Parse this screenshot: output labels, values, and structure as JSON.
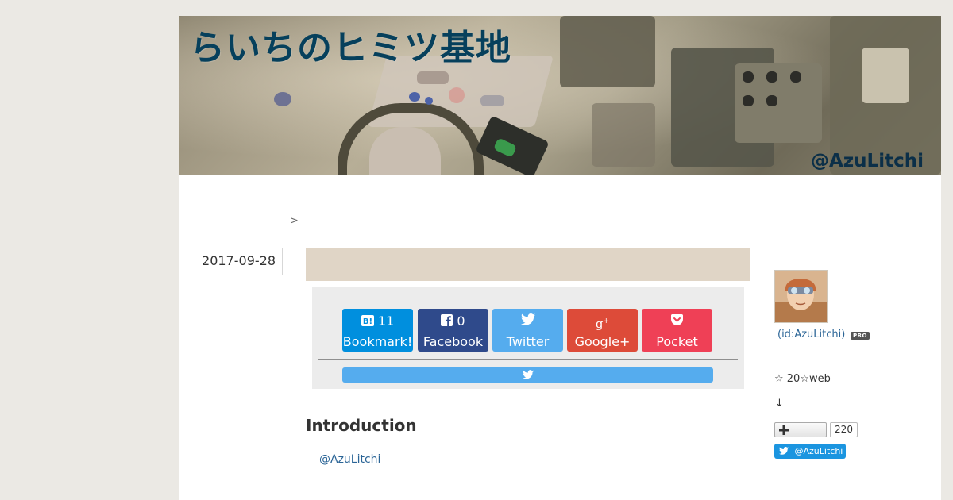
{
  "header": {
    "title": "らいちのヒミツ基地",
    "handle": "@AzuLitchi"
  },
  "breadcrumb": {
    "separator": ">"
  },
  "entry": {
    "date": "2017-09-28",
    "title": ""
  },
  "share": {
    "buttons": [
      {
        "service": "hatena",
        "count": "11",
        "label": "Bookmark!",
        "color": "#008fde",
        "icon": "hatena-bookmark-icon"
      },
      {
        "service": "facebook",
        "count": "0",
        "label": "Facebook",
        "color": "#2f4a8b",
        "icon": "facebook-icon"
      },
      {
        "service": "twitter",
        "count": "",
        "label": "Twitter",
        "color": "#55acee",
        "icon": "twitter-bird-icon"
      },
      {
        "service": "googleplus",
        "count": "",
        "label": "Google+",
        "color": "#dd4b39",
        "icon": "google-plus-icon"
      },
      {
        "service": "pocket",
        "count": "",
        "label": "Pocket",
        "color": "#ef4056",
        "icon": "pocket-icon"
      }
    ]
  },
  "content": {
    "heading": "Introduction",
    "link": "@AzuLitchi"
  },
  "sidebar": {
    "profile_id": "(id:AzuLitchi)",
    "pro_badge": "PRO",
    "description": "☆ 20☆web",
    "arrow": "↓",
    "follow_count": "220",
    "twitter_follow": "@AzuLitchi"
  },
  "colors": {
    "background": "#ebe9e4",
    "title_bar": "#e0d5c6",
    "link": "#2a6496",
    "twitter": "#55acee"
  }
}
